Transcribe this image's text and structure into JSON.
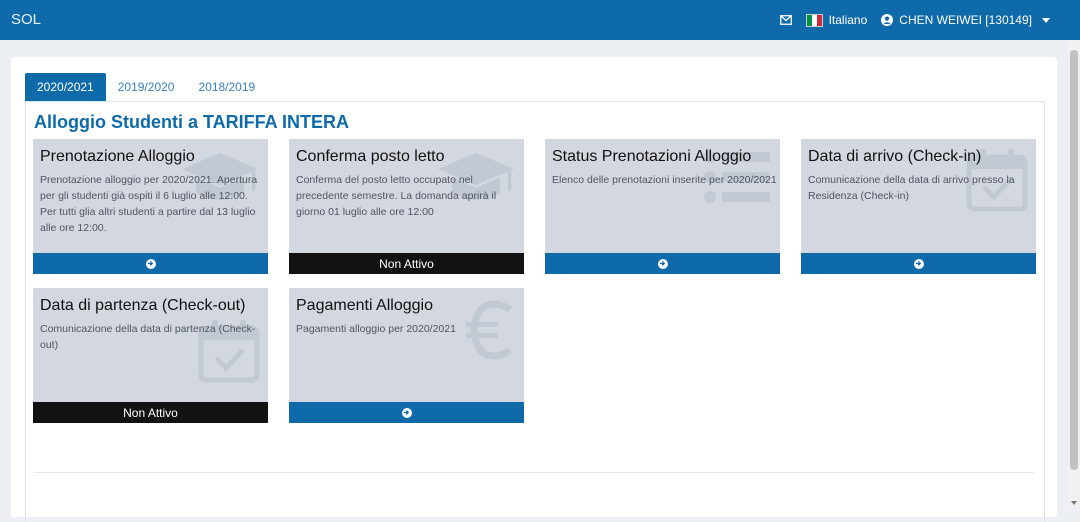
{
  "navbar": {
    "brand": "SOL",
    "language": "Italiano",
    "user": "CHEN WEIWEI [130149]"
  },
  "tabs": [
    {
      "label": "2020/2021",
      "active": true
    },
    {
      "label": "2019/2020",
      "active": false
    },
    {
      "label": "2018/2019",
      "active": false
    }
  ],
  "section": {
    "title": "Alloggio Studenti a TARIFFA INTERA"
  },
  "cards": [
    {
      "title": "Prenotazione Alloggio",
      "description": "Prenotazione alloggio per 2020/2021. Apertura per gli studenti già ospiti il 6 luglio alle 12:00. Per tutti glia altri studenti a partire dal 13 luglio alle ore 12:00.",
      "icon": "graduation-cap-icon",
      "status": "active",
      "footer_label": ""
    },
    {
      "title": "Conferma posto letto",
      "description": "Conferma del posto letto occupato nel precedente semestre. La domanda aprirà il giorno 01 luglio alle ore 12:00",
      "icon": "graduation-cap-icon",
      "status": "inactive",
      "footer_label": "Non Attivo"
    },
    {
      "title": "Status Prenotazioni Alloggio",
      "description": "Elenco delle prenotazioni inserite per 2020/2021",
      "icon": "list-icon",
      "status": "active",
      "footer_label": ""
    },
    {
      "title": "Data di arrivo (Check-in)",
      "description": "Comunicazione della data di arrivo presso la Residenza (Check-in)",
      "icon": "calendar-check-icon",
      "status": "active",
      "footer_label": ""
    },
    {
      "title": "Data di partenza (Check-out)",
      "description": "Comunicazione della data di partenza (Check-out)",
      "icon": "calendar-check-icon",
      "status": "inactive",
      "footer_label": "Non Attivo"
    },
    {
      "title": "Pagamenti Alloggio",
      "description": "Pagamenti alloggio per 2020/2021",
      "icon": "euro-icon",
      "status": "active",
      "footer_label": ""
    }
  ],
  "colors": {
    "primary": "#0e6aa8",
    "card_bg": "#d3d8e0",
    "inactive": "#121212"
  }
}
